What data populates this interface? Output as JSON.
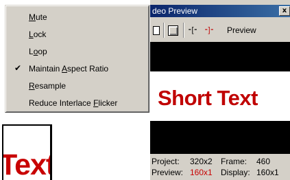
{
  "menu": {
    "items": [
      {
        "pre": "",
        "ul": "M",
        "post": "ute",
        "checked": false
      },
      {
        "pre": "",
        "ul": "L",
        "post": "ock",
        "checked": false
      },
      {
        "pre": "L",
        "ul": "o",
        "post": "op",
        "checked": false
      },
      {
        "pre": "Maintain ",
        "ul": "A",
        "post": "spect Ratio",
        "checked": true
      },
      {
        "pre": "",
        "ul": "R",
        "post": "esample",
        "checked": false
      },
      {
        "pre": "Reduce Interlace ",
        "ul": "F",
        "post": "licker",
        "checked": false
      }
    ],
    "check_glyph": "✔"
  },
  "background": {
    "text_fragment": "Text"
  },
  "preview_window": {
    "title": "deo Preview",
    "close_glyph": "x",
    "toolbar": {
      "in_glyph": "⁃[⁃",
      "out_glyph": "⁃]⁃",
      "preview_label": "Preview"
    },
    "video_text": "Short Text",
    "status": {
      "project_label": "Project:",
      "project_value": "320x2",
      "frame_label": "Frame:",
      "frame_value": "460",
      "preview_label": "Preview:",
      "preview_value": "160x1",
      "display_label": "Display:",
      "display_value": "160x1"
    }
  },
  "colors": {
    "title_bar_start": "#0a246a",
    "title_bar_end": "#3a6ea5",
    "accent_red": "#c80000",
    "face": "#d4d0c8"
  }
}
